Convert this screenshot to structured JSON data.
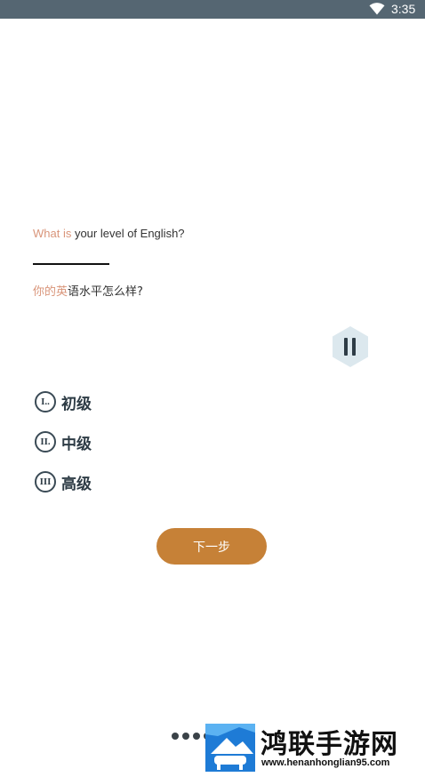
{
  "status_bar": {
    "time": "3:35",
    "wifi_icon": "wifi-icon",
    "background_color": "#556672"
  },
  "question": {
    "english_highlight": "What is",
    "english_rest": " your level of English?",
    "chinese_highlight": "你的英",
    "chinese_rest": "语水平怎么样?",
    "highlight_color": "#d9957a"
  },
  "pause_button": {
    "icon": "pause-icon"
  },
  "options": [
    {
      "badge": "I..",
      "label": "初级"
    },
    {
      "badge": "II.",
      "label": "中级"
    },
    {
      "badge": "III",
      "label": "高级"
    }
  ],
  "next_button": {
    "label": "下一步",
    "color": "#c68137"
  },
  "watermark": {
    "title": "鸿联手游网",
    "url": "www.henanhonglian95.com"
  }
}
